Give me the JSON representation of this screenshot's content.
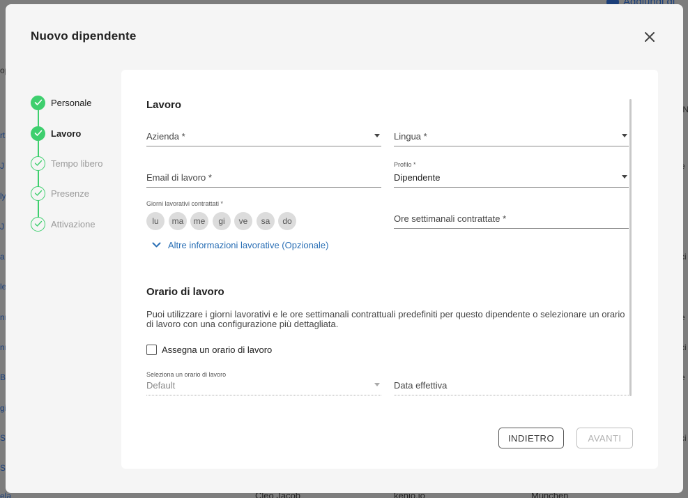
{
  "background": {
    "top_button": "Aggiungi di",
    "left_snippets": [
      "op",
      "rt",
      "J",
      "ly",
      "J",
      "a",
      "le",
      "nn",
      "nn",
      "B",
      "gi",
      "S",
      "S",
      "ela"
    ],
    "right_snippets": [
      "IN",
      "e",
      "ci",
      "e",
      "ci",
      "e",
      "ci"
    ],
    "bottom_row": {
      "name": "Cleo Jacob",
      "company": "kenjo.io",
      "city": "München"
    }
  },
  "modal": {
    "title": "Nuovo dipendente",
    "close_icon": "close-icon"
  },
  "stepper": {
    "steps": [
      {
        "label": "Personale",
        "state": "done"
      },
      {
        "label": "Lavoro",
        "state": "active"
      },
      {
        "label": "Tempo libero",
        "state": "todo"
      },
      {
        "label": "Presenze",
        "state": "todo"
      },
      {
        "label": "Attivazione",
        "state": "todo"
      }
    ]
  },
  "work": {
    "title": "Lavoro",
    "company": {
      "placeholder": "Azienda *",
      "value": ""
    },
    "language": {
      "placeholder": "Lingua *",
      "value": ""
    },
    "work_email": {
      "placeholder": "Email di lavoro *",
      "value": ""
    },
    "profile": {
      "label": "Profilo *",
      "value": "Dipendente"
    },
    "days": {
      "label": "Giorni lavorativi contrattati *",
      "items": [
        "lu",
        "ma",
        "me",
        "gi",
        "ve",
        "sa",
        "do"
      ]
    },
    "weekly_hours": {
      "placeholder": "Ore settimanali contrattate *",
      "value": ""
    },
    "more_info": "Altre informazioni lavorative (Opzionale)"
  },
  "schedule": {
    "title": "Orario di lavoro",
    "description": "Puoi utilizzare i giorni lavorativi e le ore settimanali contrattuali predefiniti per questo dipendente o selezionare un orario di lavoro con una configurazione più dettagliata.",
    "assign_label": "Assegna un orario di lavoro",
    "assign_checked": false,
    "select": {
      "label": "Seleziona un orario di lavoro",
      "value": "Default"
    },
    "effective_date": {
      "placeholder": "Data effettiva",
      "value": ""
    }
  },
  "actions": {
    "back": "INDIETRO",
    "next": "AVANTI"
  },
  "colors": {
    "step_done": "#3ecf6e",
    "link": "#2a6fb5",
    "overlay": "#7d7d7d"
  }
}
